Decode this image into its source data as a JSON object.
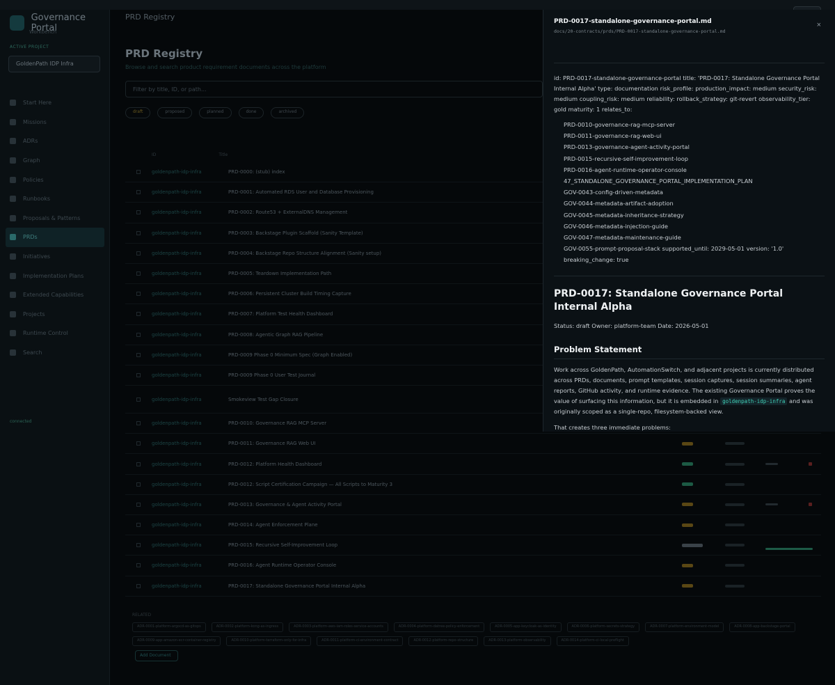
{
  "background": {
    "brand_name": "Governance Portal",
    "brand_sub": "Workbench",
    "project_label": "ACTIVE PROJECT",
    "project_value": "GoldenPath IDP Infra",
    "nav": [
      "Start Here",
      "Missions",
      "ADRs",
      "Graph",
      "Policies",
      "Runbooks",
      "Proposals & Patterns",
      "PRDs",
      "Initiatives",
      "Implementation Plans",
      "Extended Capabilities",
      "Projects",
      "Runtime Control",
      "Search"
    ],
    "active_nav_index": 7,
    "sidebar_footer": "connected",
    "crumb": "PRD Registry",
    "page_title": "PRD Registry",
    "page_desc": "Browse and search product requirement documents across the platform",
    "search_placeholder": "Filter by title, ID, or path...",
    "filters": [
      "draft",
      "proposed",
      "planned",
      "done",
      "archived"
    ],
    "table_headers": [
      "ID",
      "Title"
    ],
    "rows": [
      {
        "path": "goldenpath-idp-infra",
        "title": "PRD-0000: (stub) index"
      },
      {
        "path": "goldenpath-idp-infra",
        "title": "PRD-0001: Automated RDS User and Database Provisioning"
      },
      {
        "path": "goldenpath-idp-infra",
        "title": "PRD-0002: Route53 + ExternalDNS Management"
      },
      {
        "path": "goldenpath-idp-infra",
        "title": "PRD-0003: Backstage Plugin Scaffold (Sanity Template)"
      },
      {
        "path": "goldenpath-idp-infra",
        "title": "PRD-0004: Backstage Repo Structure Alignment (Sanity setup)"
      },
      {
        "path": "goldenpath-idp-infra",
        "title": "PRD-0005: Teardown Implementation Path"
      },
      {
        "path": "goldenpath-idp-infra",
        "title": "PRD-0006: Persistent Cluster Build Timing Capture"
      },
      {
        "path": "goldenpath-idp-infra",
        "title": "PRD-0007: Platform Test Health Dashboard"
      },
      {
        "path": "goldenpath-idp-infra",
        "title": "PRD-0008: Agentic Graph RAG Pipeline"
      },
      {
        "path": "goldenpath-idp-infra",
        "title": "PRD-0009 Phase 0 Minimum Spec (Graph Enabled)"
      },
      {
        "path": "goldenpath-idp-infra",
        "title": "PRD-0009 Phase 0 User Test Journal"
      },
      {
        "path": "goldenpath-idp-infra",
        "title": "Smokeview Test Gap Closure"
      },
      {
        "path": "goldenpath-idp-infra",
        "title": "PRD-0010: Governance RAG MCP Server"
      },
      {
        "path": "goldenpath-idp-infra",
        "title": "PRD-0011: Governance RAG Web UI"
      },
      {
        "path": "goldenpath-idp-infra",
        "title": "PRD-0012: Platform Health Dashboard"
      },
      {
        "path": "goldenpath-idp-infra",
        "title": "PRD-0012: Script Certification Campaign — All Scripts to Maturity 3"
      },
      {
        "path": "goldenpath-idp-infra",
        "title": "PRD-0013: Governance & Agent Activity Portal"
      },
      {
        "path": "goldenpath-idp-infra",
        "title": "PRD-0014: Agent Enforcement Plane"
      },
      {
        "path": "goldenpath-idp-infra",
        "title": "PRD-0015: Recursive Self-Improvement Loop"
      },
      {
        "path": "goldenpath-idp-infra",
        "title": "PRD-0016: Agent Runtime Operator Console"
      },
      {
        "path": "goldenpath-idp-infra",
        "title": "PRD-0017: Standalone Governance Portal Internal Alpha"
      }
    ],
    "footer_label": "RELATED",
    "tags": [
      "ADR-0001-platform-argocd-as-gitops",
      "ADR-0002-platform-kong-as-ingress",
      "ADR-0003-platform-aws-iam-roles-service-accounts",
      "ADR-0004-platform-datree-policy-enforcement",
      "ADR-0005-app-keycloak-as-identity",
      "ADR-0006-platform-secrets-strategy",
      "ADR-0007-platform-environment-model",
      "ADR-0008-app-backstage-portal",
      "ADR-0009-app-amazon-ecr-container-registry",
      "ADR-0010-platform-terraform-only-for-infra",
      "ADR-0011-platform-ci-environment-contract",
      "ADR-0012-platform-repo-structure",
      "ADR-0013-platform-observability",
      "ADR-0014-platform-ci-local-preflight"
    ],
    "add_button": "Add Document"
  },
  "drawer": {
    "title": "PRD-0017-standalone-governance-portal.md",
    "path": "docs/20-contracts/prds/PRD-0017-standalone-governance-portal.md",
    "close_glyph": "×",
    "frontmatter": "id: PRD-0017-standalone-governance-portal title: 'PRD-0017: Standalone Governance Portal Internal Alpha' type: documentation risk_profile: production_impact: medium security_risk: medium coupling_risk: medium reliability: rollback_strategy: git-revert observability_tier: gold maturity: 1 relates_to:",
    "relates_to": [
      "PRD-0010-governance-rag-mcp-server",
      "PRD-0011-governance-rag-web-ui",
      "PRD-0013-governance-agent-activity-portal",
      "PRD-0015-recursive-self-improvement-loop",
      "PRD-0016-agent-runtime-operator-console",
      "47_STANDALONE_GOVERNANCE_PORTAL_IMPLEMENTATION_PLAN",
      "GOV-0043-config-driven-metadata",
      "GOV-0044-metadata-artifact-adoption",
      "GOV-0045-metadata-inheritance-strategy",
      "GOV-0046-metadata-injection-guide",
      "GOV-0047-metadata-maintenance-guide",
      "GOV-0055-prompt-proposal-stack supported_until: 2029-05-01 version: '1.0' breaking_change: true"
    ],
    "h1": "PRD-0017: Standalone Governance Portal Internal Alpha",
    "status_line": "Status: draft Owner: platform-team Date: 2026-05-01",
    "h2": "Problem Statement",
    "para1_before": "Work across GoldenPath, AutomationSwitch, and adjacent projects is currently distributed across PRDs, documents, prompt templates, session captures, session summaries, agent reports, GitHub activity, and runtime evidence. The existing Governance Portal proves the value of surfacing this information, but it is embedded in ",
    "para1_code": "goldenpath-idp-infra",
    "para1_after": " and was originally scoped as a single-repo, filesystem-backed view.",
    "para2": "That creates three immediate problems:"
  }
}
